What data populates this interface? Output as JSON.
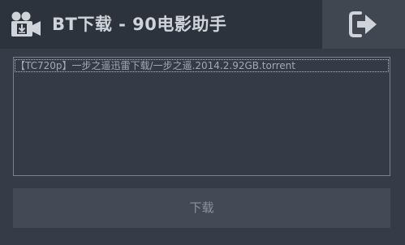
{
  "header": {
    "title": "BT下载 - 90电影助手",
    "app_icon": "film-camera-download-icon",
    "exit_icon": "exit-door-arrow-icon"
  },
  "torrent_list": {
    "items": [
      {
        "name": "【TC720p】一步之遥迅雷下载/一步之遥.2014.2.92GB.torrent"
      }
    ]
  },
  "actions": {
    "download_label": "下载"
  },
  "colors": {
    "window_bg": "#363c47",
    "titlebar_bg": "#2d333d",
    "exit_button_bg": "#404751",
    "download_button_bg": "#434a55"
  }
}
